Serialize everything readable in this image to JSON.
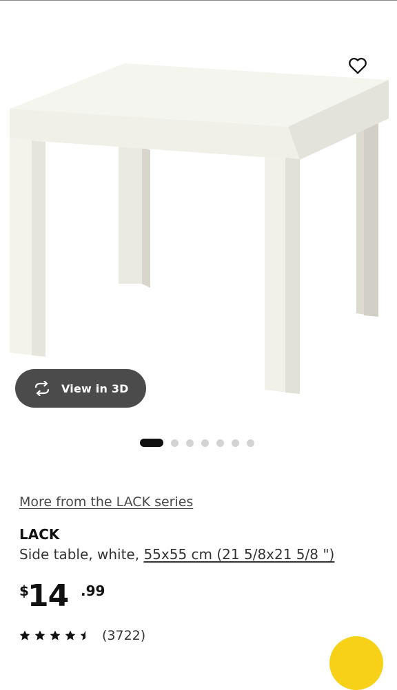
{
  "product_image": {
    "icon": "lack-side-table-image"
  },
  "favorite": {
    "icon": "heart-icon"
  },
  "view_3d": {
    "label": "View in 3D",
    "icon": "rotate-3d-icon"
  },
  "carousel": {
    "total": 7,
    "active_index": 0
  },
  "series_link": "More from the LACK series",
  "product": {
    "name": "LACK",
    "description_prefix": "Side table, white, ",
    "measurement": "55x55 cm (21 5/8x21 5/8 \")",
    "price": {
      "currency": "$",
      "integer": "14",
      "decimal": ".99"
    },
    "rating": {
      "value": 4.5,
      "max": 5,
      "count_text": "(3722)"
    }
  },
  "colors": {
    "accent": "#f7d117",
    "button_dark": "#4b4b4b",
    "text": "#111111",
    "dot_inactive": "#d3d3d3"
  }
}
